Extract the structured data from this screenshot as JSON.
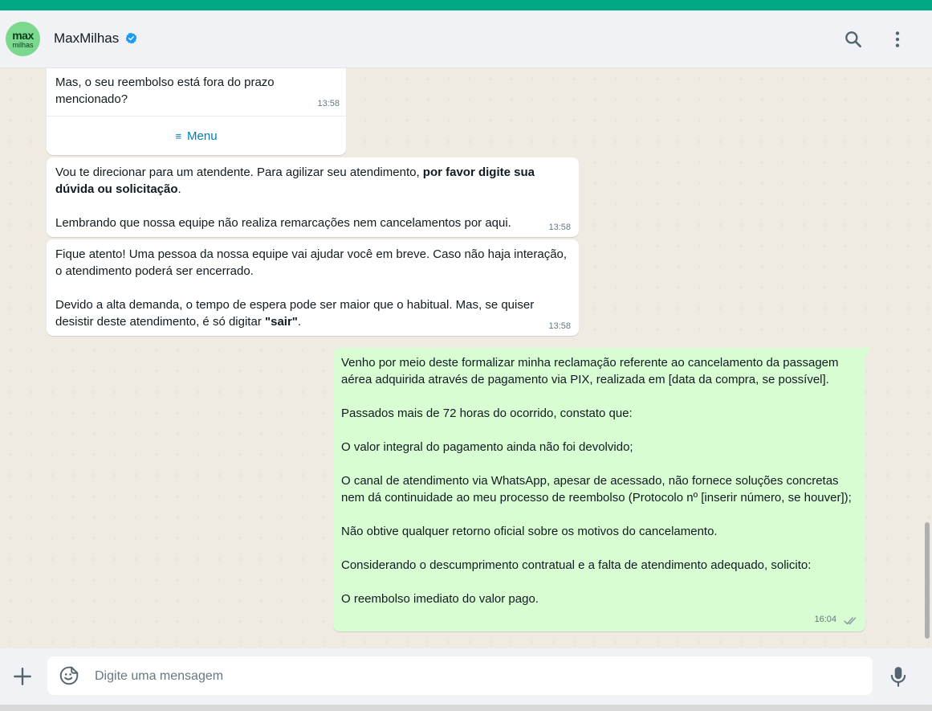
{
  "header": {
    "avatar_line1": "max",
    "avatar_line2": "milhas",
    "contact_name": "MaxMilhas",
    "search_icon": "search-icon",
    "menu_icon": "more-vertical-icon"
  },
  "colors": {
    "accent": "#00a884",
    "outgoing_bubble": "#d9fdd3",
    "incoming_bubble": "#ffffff",
    "link": "#027eb5",
    "verified": "#1d9bf0"
  },
  "messages": [
    {
      "direction": "incoming",
      "text": "Mas, o seu reembolso está fora do prazo mencionado?",
      "time": "13:58",
      "button_label": "Menu"
    },
    {
      "direction": "incoming",
      "p1_normal": "Vou te direcionar para um atendente. Para agilizar seu atendimento, ",
      "p1_bold": "por favor digite sua dúvida ou solicitação",
      "p1_end": ".",
      "p2": "Lembrando que nossa equipe não realiza remarcações nem cancelamentos por aqui.",
      "time": "13:58"
    },
    {
      "direction": "incoming",
      "p1": "Fique atento! Uma pessoa da nossa equipe vai ajudar você em breve. Caso não haja interação, o atendimento poderá ser encerrado.",
      "p2_normal": "Devido a alta demanda, o tempo de espera pode ser maior que o habitual. Mas, se quiser desistir deste atendimento, é só digitar ",
      "p2_bold": "\"sair\"",
      "p2_end": ".",
      "time": "13:58"
    },
    {
      "direction": "outgoing",
      "paragraphs": [
        "Venho por meio deste formalizar minha reclamação referente ao cancelamento da passagem aérea adquirida através de pagamento via PIX, realizada em [data da compra, se possível].",
        "Passados mais de 72 horas do ocorrido, constato que:",
        "O valor integral do pagamento ainda não foi devolvido;",
        "O canal de atendimento via WhatsApp, apesar de acessado, não fornece soluções concretas nem dá continuidade ao meu processo de reembolso (Protocolo nº [inserir número, se houver]);",
        "Não obtive qualquer retorno oficial sobre os motivos do cancelamento.",
        "Considerando o descumprimento contratual e a falta de atendimento adequado, solicito:",
        "O reembolso imediato do valor pago."
      ],
      "time": "16:04",
      "status": "read"
    }
  ],
  "composer": {
    "placeholder": "Digite uma mensagem",
    "plus_icon": "plus-icon",
    "sticker_icon": "sticker-icon",
    "mic_icon": "mic-icon"
  }
}
